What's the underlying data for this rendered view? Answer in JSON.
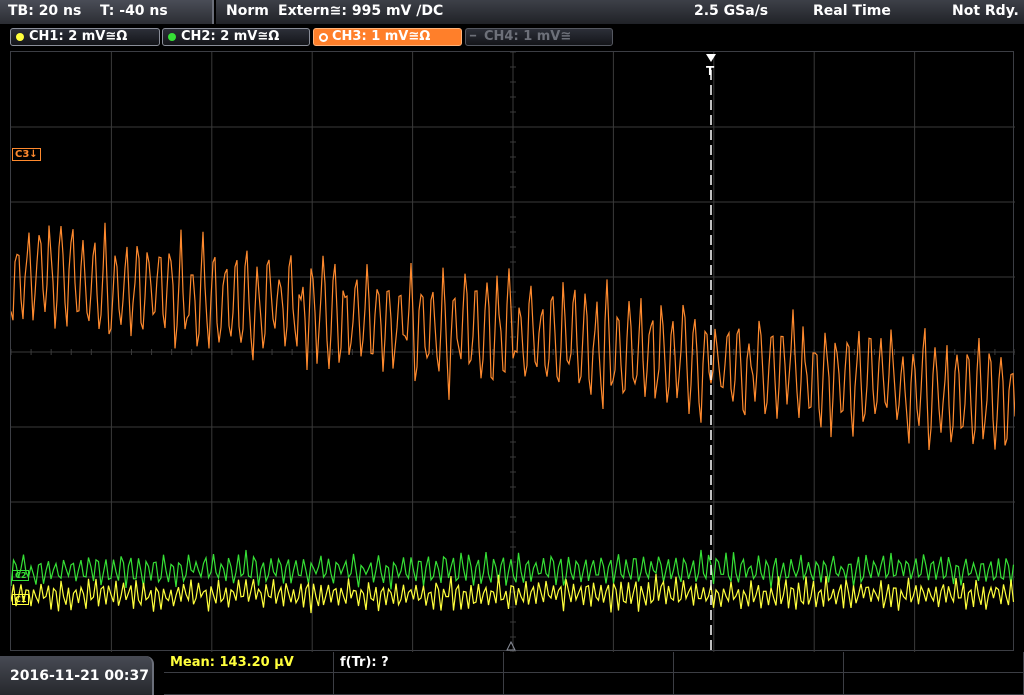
{
  "header": {
    "timebase": "TB: 20 ns",
    "trigger_pos": "T: -40 ns",
    "mode": "Norm",
    "trigger_source": "Extern≅: 995 mV ∕DC",
    "sample_rate": "2.5 GSa/s",
    "acq_mode": "Real Time",
    "status": "Not Rdy."
  },
  "channels": [
    {
      "label": "CH1: 2 mV≅Ω",
      "color": "#ffff3c",
      "state": "on"
    },
    {
      "label": "CH2: 2 mV≅Ω",
      "color": "#36e036",
      "state": "on"
    },
    {
      "label": "CH3: 1 mV≅Ω",
      "color": "#ff8a2e",
      "state": "active"
    },
    {
      "label": "CH4: 1 mV≅",
      "color": "#6d7079",
      "state": "off"
    }
  ],
  "markers": {
    "ch3": "C3↓",
    "ch2": "C2",
    "ch1": "C1",
    "trigger": "T"
  },
  "footer": {
    "datetime": "2016-11-21 00:37",
    "mean_label": "Mean: 143.20 µV",
    "ftr_label": "f(Tr): ?"
  },
  "colors": {
    "grid": "#3a3a3a",
    "ch1": "#ffff3c",
    "ch2": "#36e036",
    "ch3": "#ff8a2e",
    "trigger_line": "#ffffff"
  }
}
